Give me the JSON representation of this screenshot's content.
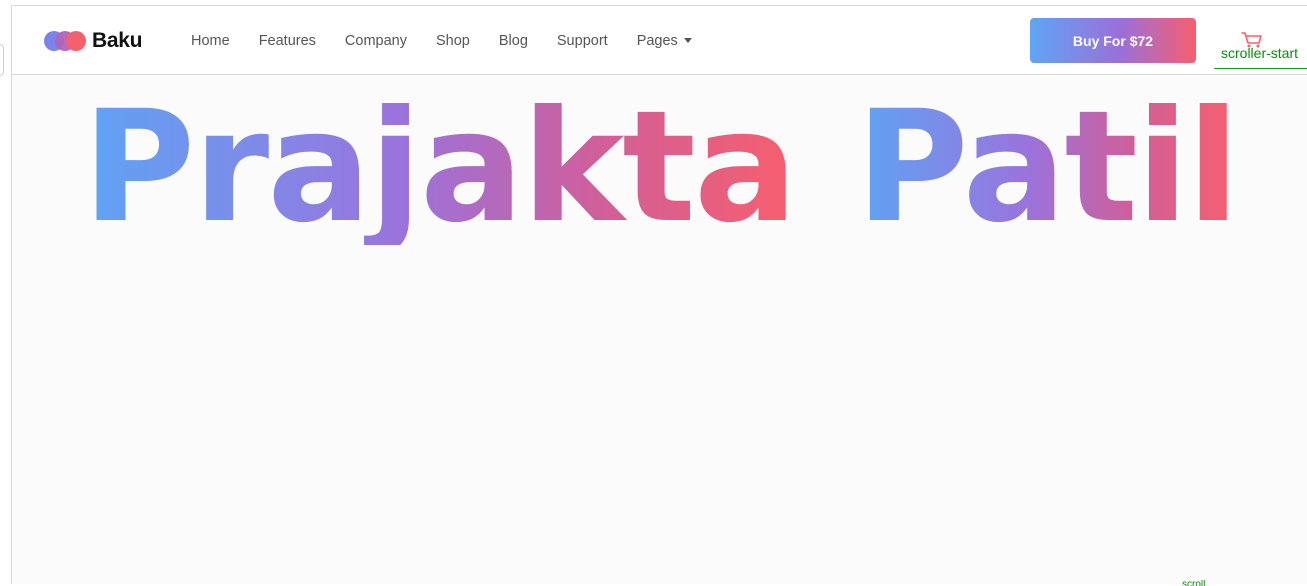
{
  "brand": {
    "name": "Baku",
    "logo_colors": [
      "#7b83eb",
      "#b263b8",
      "#f4606b"
    ]
  },
  "nav": {
    "items": [
      {
        "label": "Home"
      },
      {
        "label": "Features"
      },
      {
        "label": "Company"
      },
      {
        "label": "Shop"
      },
      {
        "label": "Blog"
      },
      {
        "label": "Support"
      },
      {
        "label": "Pages",
        "has_dropdown": true
      }
    ]
  },
  "header": {
    "buy_label": "Buy For $72",
    "buy_gradient": [
      "#5fa5f5",
      "#9b6fd9",
      "#f75f6d"
    ],
    "cart_icon": "shopping-cart-icon",
    "cart_color": "#f4606b"
  },
  "debug": {
    "scroller_start_label": "scroller-start",
    "scroller_marker_color": "#0e8a0e"
  },
  "hero": {
    "words": [
      "Prajakta",
      "Patil"
    ],
    "gradient": [
      "#5ea4f5",
      "#9b73dc",
      "#f75f6d"
    ]
  }
}
